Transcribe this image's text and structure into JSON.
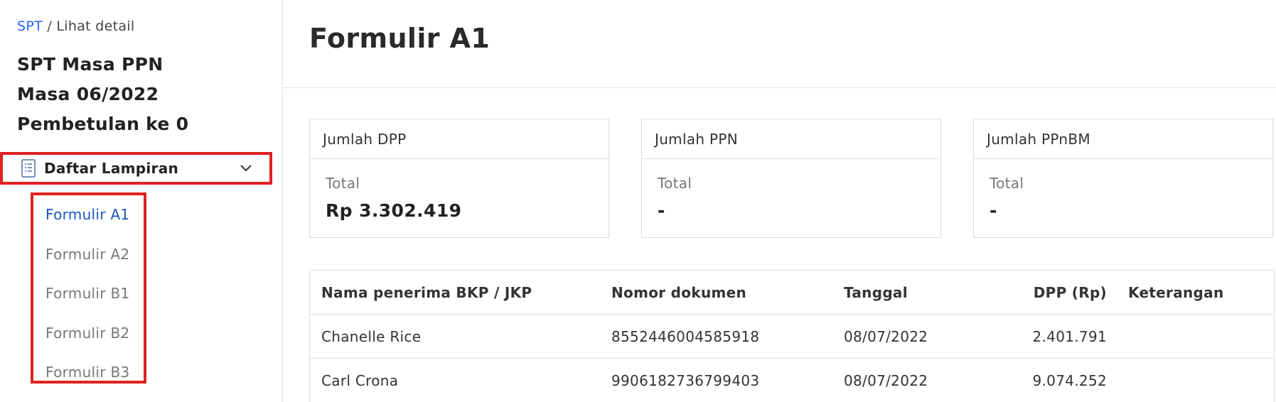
{
  "breadcrumb": {
    "link": "SPT",
    "separator": " / ",
    "current": "Lihat detail"
  },
  "sidebar": {
    "title_lines": [
      "SPT Masa PPN",
      "Masa 06/2022",
      "Pembetulan ke 0"
    ],
    "section": {
      "label": "Daftar Lampiran",
      "icon": "document-list-icon",
      "toggle_icon": "chevron-down-icon"
    },
    "items": [
      {
        "label": "Formulir A1",
        "active": true
      },
      {
        "label": "Formulir A2",
        "active": false
      },
      {
        "label": "Formulir B1",
        "active": false
      },
      {
        "label": "Formulir B2",
        "active": false
      },
      {
        "label": "Formulir B3",
        "active": false
      }
    ]
  },
  "main": {
    "title": "Formulir A1",
    "cards": [
      {
        "title": "Jumlah DPP",
        "total_label": "Total",
        "total_value": "Rp 3.302.419"
      },
      {
        "title": "Jumlah PPN",
        "total_label": "Total",
        "total_value": "-"
      },
      {
        "title": "Jumlah PPnBM",
        "total_label": "Total",
        "total_value": "-"
      }
    ],
    "table": {
      "headers": {
        "name": "Nama penerima BKP / JKP",
        "doc": "Nomor dokumen",
        "date": "Tanggal",
        "dpp": "DPP (Rp)",
        "ket": "Keterangan"
      },
      "rows": [
        {
          "name": "Chanelle Rice",
          "doc": "8552446004585918",
          "date": "08/07/2022",
          "dpp": "2.401.791",
          "ket": ""
        },
        {
          "name": "Carl Crona",
          "doc": "9906182736799403",
          "date": "08/07/2022",
          "dpp": "9.074.252",
          "ket": ""
        }
      ]
    }
  },
  "colors": {
    "highlight_border": "#e02020",
    "link": "#2962ff",
    "active_item": "#1a56c2"
  }
}
